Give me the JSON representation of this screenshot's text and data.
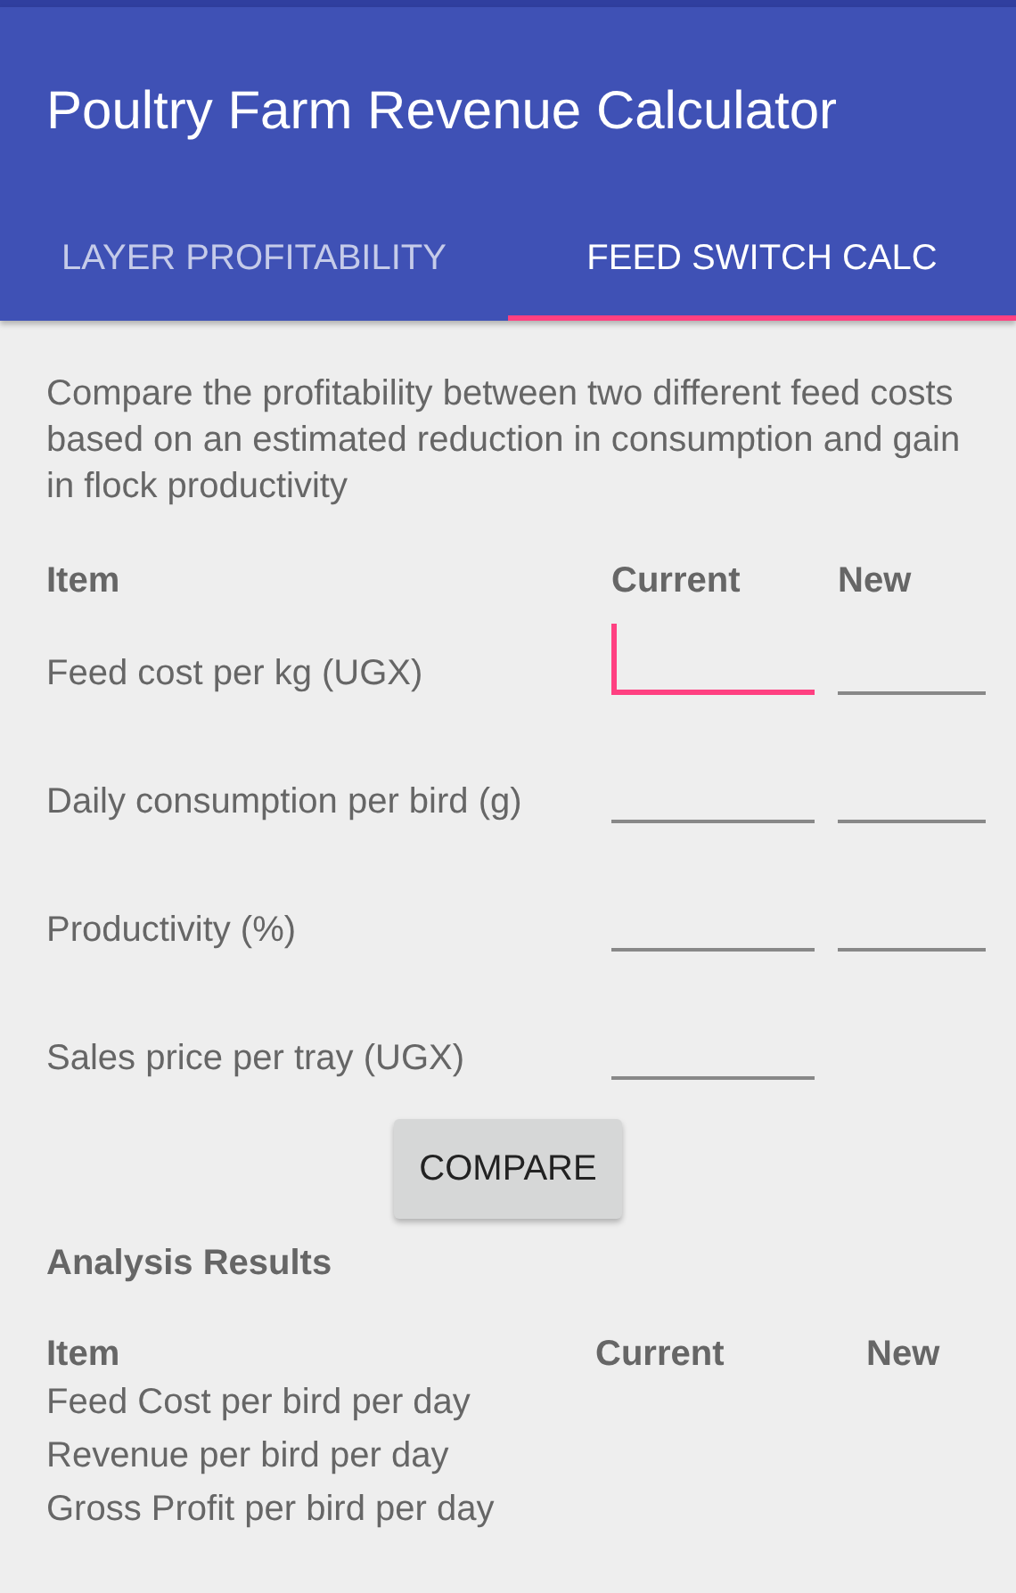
{
  "app_bar": {
    "title": "Poultry Farm Revenue Calculator"
  },
  "tabs": [
    {
      "label": "LAYER PROFITABILITY",
      "selected": false
    },
    {
      "label": "FEED SWITCH CALC",
      "selected": true
    }
  ],
  "description": "Compare the profitability between two different feed costs based on an estimated reduction in consumption and gain in flock productivity",
  "form": {
    "columns": [
      "Item",
      "Current",
      "New"
    ],
    "rows": [
      {
        "label": "Feed cost per kg (UGX)",
        "fields": [
          {
            "focused": true
          },
          {
            "focused": false
          }
        ]
      },
      {
        "label": "Daily consumption per bird (g)",
        "fields": [
          {
            "focused": false
          },
          {
            "focused": false
          }
        ]
      },
      {
        "label": "Productivity (%)",
        "fields": [
          {
            "focused": false
          },
          {
            "focused": false
          }
        ]
      },
      {
        "label": "Sales price per tray (UGX)",
        "fields": [
          {
            "focused": false
          }
        ]
      }
    ]
  },
  "compare_button": "COMPARE",
  "results": {
    "title": "Analysis Results",
    "columns": [
      "Item",
      "Current",
      "New"
    ],
    "rows": [
      "Feed Cost per bird per day",
      "Revenue per bird per day",
      "Gross Profit per bird per day"
    ]
  }
}
